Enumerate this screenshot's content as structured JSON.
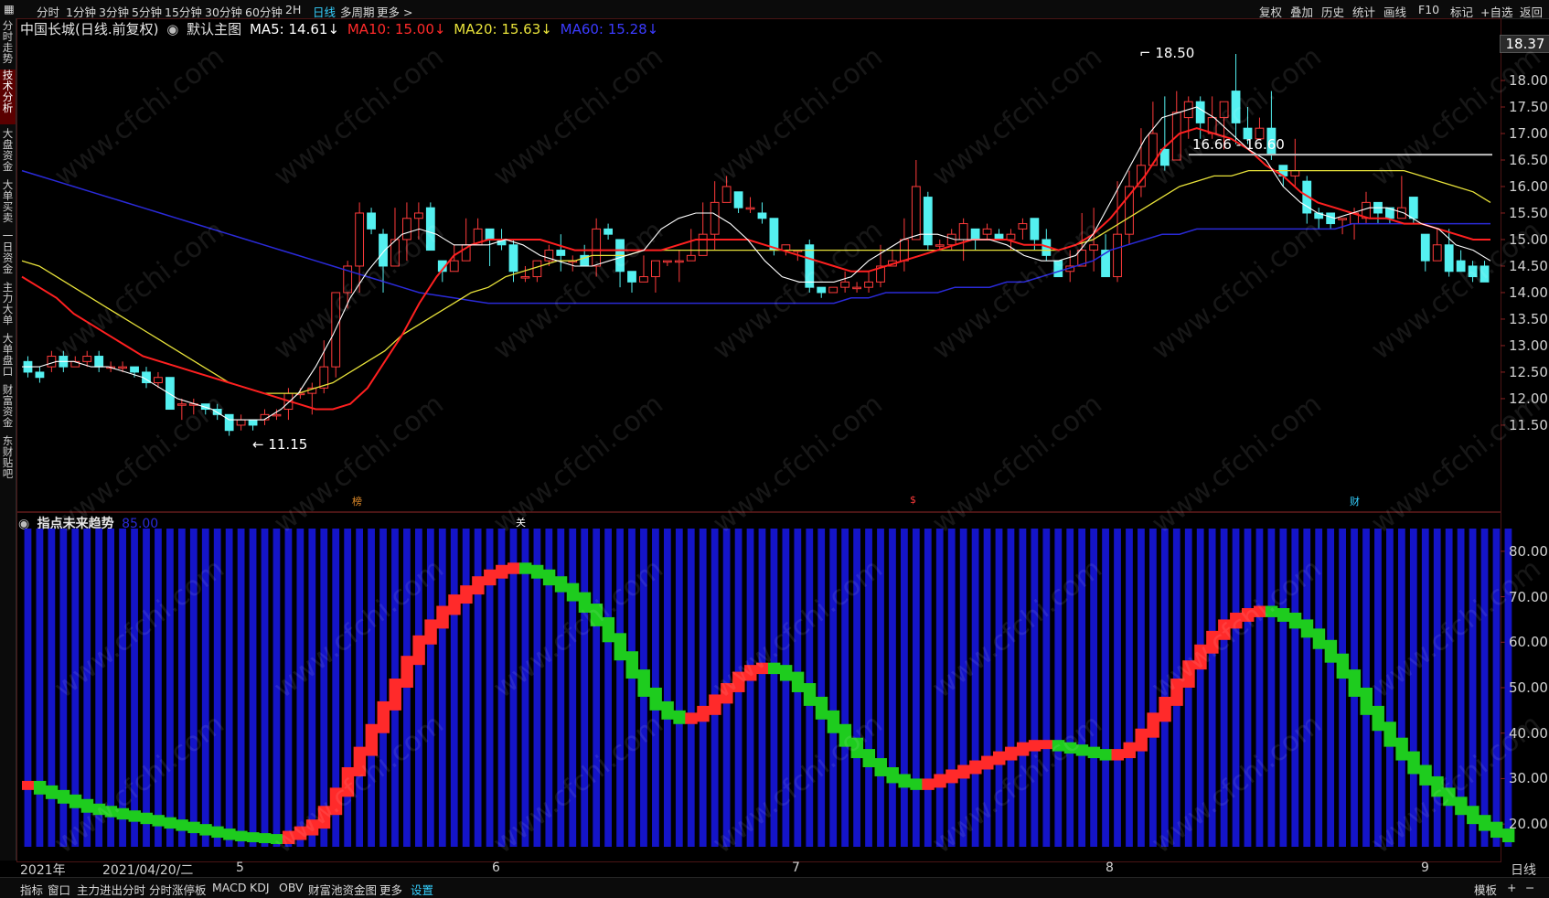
{
  "topbar": {
    "left_items": [
      "分时",
      "1分钟",
      "3分钟",
      "5分钟",
      "15分钟",
      "30分钟",
      "60分钟",
      "2H",
      "日线",
      "多周期",
      "更多 >"
    ],
    "active_item": "日线",
    "right_items": [
      "复权",
      "叠加",
      "历史",
      "统计",
      "画线",
      "F10",
      "标记",
      "+自选",
      "返回"
    ]
  },
  "sidebar": {
    "items": [
      "分时走势",
      "技术分析",
      "大盘资金",
      "大单买卖",
      "一日资金",
      "主力大单",
      "大单盘口",
      "财富资金",
      "东财贴吧"
    ],
    "active": "技术分析"
  },
  "legend": {
    "stock": "中国长城(日线.前复权)",
    "template": "默认主图",
    "ma5": "MA5: 14.61↓",
    "ma10": "MA10: 15.00↓",
    "ma20": "MA20: 15.63↓",
    "ma60": "MA60: 15.28↓"
  },
  "colors": {
    "up": "#ff3b3b",
    "down": "#54f0f0",
    "ma5": "#ffffff",
    "ma10": "#ff2020",
    "ma20": "#e8e23a",
    "ma60": "#2a2ad8",
    "osc_blue": "#1414c8",
    "osc_red": "#ff2a2a",
    "osc_green": "#1ecc1e"
  },
  "price_box": "18.37",
  "annotations": {
    "high": "18.50",
    "low": "11.15",
    "hline_label": "16.66 - 16.60",
    "markers": [
      "榜",
      "$",
      "财"
    ]
  },
  "sub_legend": {
    "title": "指点未来趋势",
    "value": "85.00"
  },
  "sub_marker": "关",
  "bottombar": {
    "items": [
      "指标",
      "窗口",
      "主力进出分时",
      "分时涨停板",
      "MACD",
      "KDJ",
      "OBV",
      "财富池资金图",
      "更多",
      "设置"
    ],
    "active": "设置",
    "right_items": [
      "模板",
      "+",
      "−"
    ]
  },
  "watermark": "www.cfchi.com",
  "chart_data": [
    {
      "type": "candlestick",
      "title": "中国长城(日线.前复权)",
      "period_label": "日线",
      "x_labels": [
        "2021年",
        "2021/04/20/二",
        "5",
        "6",
        "7",
        "8",
        "9"
      ],
      "ylim": [
        11.15,
        18.5
      ],
      "yticks": [
        11.5,
        12.0,
        12.5,
        13.0,
        13.5,
        14.0,
        14.5,
        15.0,
        15.5,
        16.0,
        16.5,
        17.0,
        17.5,
        18.0
      ],
      "candles": [
        [
          12.7,
          12.5,
          12.8,
          12.4
        ],
        [
          12.5,
          12.4,
          12.6,
          12.3
        ],
        [
          12.6,
          12.8,
          12.9,
          12.5
        ],
        [
          12.8,
          12.6,
          12.9,
          12.5
        ],
        [
          12.6,
          12.7,
          12.8,
          12.6
        ],
        [
          12.7,
          12.8,
          12.9,
          12.6
        ],
        [
          12.8,
          12.6,
          12.9,
          12.5
        ],
        [
          12.6,
          12.6,
          12.7,
          12.5
        ],
        [
          12.6,
          12.6,
          12.7,
          12.5
        ],
        [
          12.6,
          12.5,
          12.6,
          12.4
        ],
        [
          12.5,
          12.3,
          12.6,
          12.2
        ],
        [
          12.3,
          12.4,
          12.5,
          12.2
        ],
        [
          12.4,
          11.8,
          12.4,
          11.8
        ],
        [
          11.9,
          11.9,
          12.0,
          11.6
        ],
        [
          11.9,
          11.9,
          12.0,
          11.7
        ],
        [
          11.9,
          11.8,
          11.9,
          11.7
        ],
        [
          11.8,
          11.7,
          11.9,
          11.6
        ],
        [
          11.7,
          11.4,
          11.7,
          11.3
        ],
        [
          11.5,
          11.6,
          11.7,
          11.4
        ],
        [
          11.6,
          11.5,
          11.6,
          11.4
        ],
        [
          11.6,
          11.7,
          11.8,
          11.5
        ],
        [
          11.7,
          11.7,
          11.8,
          11.6
        ],
        [
          11.8,
          12.1,
          12.2,
          11.6
        ],
        [
          12.1,
          12.1,
          12.2,
          12.0
        ],
        [
          12.1,
          12.2,
          12.3,
          11.7
        ],
        [
          12.2,
          12.6,
          13.1,
          12.1
        ],
        [
          12.6,
          14.0,
          14.0,
          12.4
        ],
        [
          14.0,
          14.5,
          14.6,
          13.7
        ],
        [
          14.5,
          15.5,
          15.7,
          14.0
        ],
        [
          15.5,
          15.2,
          15.6,
          15.1
        ],
        [
          15.1,
          14.5,
          15.2,
          14.0
        ],
        [
          14.5,
          15.0,
          15.6,
          14.6
        ],
        [
          15.0,
          15.4,
          15.7,
          14.6
        ],
        [
          15.4,
          15.5,
          15.7,
          15.0
        ],
        [
          15.6,
          14.8,
          15.7,
          14.8
        ],
        [
          14.6,
          14.4,
          14.6,
          14.2
        ],
        [
          14.4,
          14.6,
          14.9,
          14.4
        ],
        [
          14.6,
          14.9,
          15.4,
          14.6
        ],
        [
          14.9,
          15.2,
          15.4,
          14.9
        ],
        [
          15.2,
          15.0,
          15.2,
          14.5
        ],
        [
          15.0,
          14.9,
          15.2,
          14.8
        ],
        [
          14.9,
          14.4,
          15.0,
          14.2
        ],
        [
          14.3,
          14.3,
          14.5,
          14.2
        ],
        [
          14.3,
          14.6,
          14.6,
          14.2
        ],
        [
          14.6,
          14.8,
          14.9,
          14.5
        ],
        [
          14.8,
          14.7,
          15.1,
          14.4
        ],
        [
          14.6,
          14.6,
          14.7,
          14.4
        ],
        [
          14.7,
          14.5,
          14.9,
          14.5
        ],
        [
          14.5,
          15.2,
          15.4,
          14.3
        ],
        [
          15.2,
          15.1,
          15.3,
          15.0
        ],
        [
          15.0,
          14.4,
          15.0,
          14.1
        ],
        [
          14.4,
          14.2,
          14.4,
          14.0
        ],
        [
          14.2,
          14.3,
          14.7,
          14.2
        ],
        [
          14.3,
          14.6,
          14.6,
          14.0
        ],
        [
          14.6,
          14.6,
          14.6,
          14.5
        ],
        [
          14.6,
          14.6,
          14.8,
          14.2
        ],
        [
          14.6,
          14.7,
          15.2,
          14.6
        ],
        [
          14.7,
          15.1,
          15.7,
          14.8
        ],
        [
          15.1,
          15.7,
          16.1,
          14.8
        ],
        [
          15.7,
          16.0,
          16.2,
          15.8
        ],
        [
          15.9,
          15.6,
          15.9,
          15.5
        ],
        [
          15.6,
          15.6,
          15.8,
          15.5
        ],
        [
          15.5,
          15.4,
          15.7,
          15.3
        ],
        [
          15.4,
          14.8,
          15.4,
          14.7
        ],
        [
          14.8,
          14.9,
          14.9,
          14.7
        ],
        [
          14.8,
          14.8,
          14.8,
          14.6
        ],
        [
          14.9,
          14.1,
          15.0,
          14.0
        ],
        [
          14.1,
          14.0,
          14.1,
          13.9
        ],
        [
          14.0,
          14.1,
          14.1,
          14.0
        ],
        [
          14.1,
          14.2,
          14.4,
          14.0
        ],
        [
          14.1,
          14.1,
          14.2,
          14.0
        ],
        [
          14.1,
          14.2,
          14.4,
          14.0
        ],
        [
          14.2,
          14.5,
          14.9,
          14.1
        ],
        [
          14.5,
          14.6,
          14.8,
          14.5
        ],
        [
          14.6,
          15.0,
          15.4,
          14.4
        ],
        [
          15.0,
          16.0,
          16.5,
          15.0
        ],
        [
          15.8,
          14.9,
          15.9,
          14.8
        ],
        [
          14.9,
          14.9,
          15.0,
          14.8
        ],
        [
          14.9,
          15.1,
          15.2,
          14.8
        ],
        [
          15.0,
          15.3,
          15.4,
          14.6
        ],
        [
          15.2,
          15.0,
          15.2,
          14.8
        ],
        [
          15.1,
          15.2,
          15.3,
          15.0
        ],
        [
          15.1,
          15.0,
          15.2,
          15.0
        ],
        [
          15.0,
          15.1,
          15.2,
          14.8
        ],
        [
          15.2,
          15.3,
          15.4,
          15.0
        ],
        [
          15.4,
          15.0,
          15.4,
          14.8
        ],
        [
          15.0,
          14.7,
          15.2,
          14.6
        ],
        [
          14.6,
          14.3,
          14.6,
          14.3
        ],
        [
          14.4,
          14.5,
          14.8,
          14.2
        ],
        [
          14.5,
          14.8,
          15.5,
          14.5
        ],
        [
          14.8,
          14.9,
          15.6,
          14.4
        ],
        [
          14.8,
          14.3,
          15.1,
          14.3
        ],
        [
          14.3,
          15.1,
          16.1,
          14.2
        ],
        [
          15.1,
          16.0,
          16.3,
          14.9
        ],
        [
          16.0,
          16.4,
          17.1,
          15.8
        ],
        [
          16.4,
          17.0,
          17.6,
          16.4
        ],
        [
          16.7,
          16.4,
          17.7,
          16.3
        ],
        [
          16.5,
          17.4,
          17.8,
          16.5
        ],
        [
          17.3,
          17.6,
          17.7,
          16.9
        ],
        [
          17.6,
          17.2,
          17.7,
          16.9
        ],
        [
          17.0,
          17.3,
          17.7,
          16.9
        ],
        [
          17.3,
          17.6,
          17.6,
          16.7
        ],
        [
          17.8,
          17.2,
          18.5,
          16.8
        ],
        [
          17.1,
          16.9,
          17.5,
          16.8
        ],
        [
          16.9,
          17.1,
          17.3,
          16.9
        ],
        [
          17.1,
          16.6,
          17.8,
          16.5
        ],
        [
          16.4,
          16.2,
          16.4,
          16.0
        ],
        [
          16.2,
          16.3,
          16.9,
          16.0
        ],
        [
          16.1,
          15.5,
          16.2,
          15.3
        ],
        [
          15.5,
          15.4,
          15.6,
          15.2
        ],
        [
          15.5,
          15.3,
          15.4,
          15.2
        ],
        [
          15.4,
          15.4,
          15.3,
          15.1
        ],
        [
          15.3,
          15.5,
          15.6,
          15.0
        ],
        [
          15.4,
          15.7,
          15.9,
          15.3
        ],
        [
          15.7,
          15.5,
          15.7,
          15.3
        ],
        [
          15.6,
          15.4,
          15.6,
          15.3
        ],
        [
          15.4,
          15.6,
          16.2,
          15.4
        ],
        [
          15.8,
          15.4,
          15.8,
          15.3
        ],
        [
          15.1,
          14.6,
          15.1,
          14.4
        ],
        [
          14.6,
          14.9,
          15.2,
          14.6
        ],
        [
          14.9,
          14.4,
          15.2,
          14.3
        ],
        [
          14.6,
          14.4,
          14.8,
          14.4
        ],
        [
          14.5,
          14.3,
          14.6,
          14.2
        ],
        [
          14.5,
          14.2,
          14.6,
          14.2
        ]
      ],
      "ma5": [
        12.6,
        12.6,
        12.7,
        12.7,
        12.6,
        12.6,
        12.5,
        12.4,
        12.2,
        12.0,
        11.9,
        11.8,
        11.6,
        11.6,
        11.6,
        11.8,
        12.1,
        12.6,
        13.2,
        13.9,
        14.4,
        14.8,
        15.1,
        15.2,
        15.1,
        14.9,
        14.9,
        14.9,
        15.0,
        14.9,
        14.7,
        14.6,
        14.5,
        14.5,
        14.6,
        14.7,
        14.8,
        15.2,
        15.4,
        15.5,
        15.5,
        15.3,
        15.0,
        14.6,
        14.3,
        14.2,
        14.2,
        14.2,
        14.3,
        14.6,
        14.8,
        15.0,
        15.1,
        15.1,
        15.0,
        15.0,
        15.0,
        14.9,
        14.7,
        14.6,
        14.6,
        14.7,
        15.1,
        15.7,
        16.3,
        16.9,
        17.3,
        17.4,
        17.5,
        17.3,
        17.0,
        16.7,
        16.5,
        16.0,
        15.7,
        15.5,
        15.4,
        15.5,
        15.6,
        15.6,
        15.5,
        15.3,
        15.2,
        14.9,
        14.8,
        14.6
      ],
      "ma10": [
        14.3,
        14.1,
        13.9,
        13.6,
        13.4,
        13.2,
        13.0,
        12.8,
        12.7,
        12.6,
        12.5,
        12.4,
        12.3,
        12.2,
        12.1,
        12.0,
        11.9,
        11.8,
        11.8,
        11.9,
        12.2,
        12.7,
        13.2,
        13.8,
        14.3,
        14.7,
        14.9,
        15.0,
        15.0,
        15.0,
        15.0,
        14.9,
        14.8,
        14.8,
        14.8,
        14.8,
        14.8,
        14.8,
        14.9,
        15.0,
        15.0,
        15.0,
        15.0,
        14.9,
        14.8,
        14.7,
        14.6,
        14.5,
        14.4,
        14.4,
        14.5,
        14.6,
        14.7,
        14.8,
        14.9,
        15.0,
        15.0,
        15.0,
        14.9,
        14.9,
        14.8,
        14.9,
        15.1,
        15.4,
        15.8,
        16.2,
        16.7,
        17.0,
        17.1,
        17.0,
        16.9,
        16.7,
        16.4,
        16.2,
        15.9,
        15.7,
        15.6,
        15.5,
        15.4,
        15.4,
        15.3,
        15.3,
        15.2,
        15.1,
        15.0,
        15.0
      ],
      "ma20": [
        14.6,
        14.5,
        14.3,
        14.1,
        13.9,
        13.7,
        13.5,
        13.3,
        13.1,
        12.9,
        12.7,
        12.5,
        12.3,
        12.2,
        12.1,
        12.1,
        12.1,
        12.2,
        12.3,
        12.5,
        12.7,
        12.9,
        13.2,
        13.4,
        13.6,
        13.8,
        14.0,
        14.1,
        14.3,
        14.4,
        14.5,
        14.6,
        14.6,
        14.7,
        14.7,
        14.7,
        14.8,
        14.8,
        14.8,
        14.8,
        14.8,
        14.8,
        14.8,
        14.8,
        14.8,
        14.8,
        14.8,
        14.8,
        14.8,
        14.8,
        14.8,
        14.8,
        14.8,
        14.8,
        14.8,
        14.8,
        14.8,
        14.8,
        14.8,
        14.8,
        14.8,
        14.9,
        15.0,
        15.2,
        15.4,
        15.6,
        15.8,
        16.0,
        16.1,
        16.2,
        16.2,
        16.3,
        16.3,
        16.3,
        16.3,
        16.3,
        16.3,
        16.3,
        16.3,
        16.3,
        16.3,
        16.2,
        16.1,
        16.0,
        15.9,
        15.7
      ],
      "ma60": [
        16.3,
        16.2,
        16.1,
        16.0,
        15.9,
        15.8,
        15.7,
        15.6,
        15.5,
        15.4,
        15.3,
        15.2,
        15.1,
        15.0,
        14.9,
        14.8,
        14.7,
        14.6,
        14.5,
        14.4,
        14.3,
        14.2,
        14.1,
        14.0,
        13.95,
        13.9,
        13.85,
        13.8,
        13.8,
        13.8,
        13.8,
        13.8,
        13.8,
        13.8,
        13.8,
        13.8,
        13.8,
        13.8,
        13.8,
        13.8,
        13.8,
        13.8,
        13.8,
        13.8,
        13.8,
        13.8,
        13.8,
        13.8,
        13.9,
        13.9,
        14.0,
        14.0,
        14.0,
        14.0,
        14.1,
        14.1,
        14.1,
        14.2,
        14.2,
        14.3,
        14.4,
        14.5,
        14.6,
        14.8,
        14.9,
        15.0,
        15.1,
        15.1,
        15.2,
        15.2,
        15.2,
        15.2,
        15.2,
        15.2,
        15.2,
        15.2,
        15.2,
        15.3,
        15.3,
        15.3,
        15.3,
        15.3,
        15.3,
        15.3,
        15.3,
        15.3
      ]
    },
    {
      "type": "bar",
      "title": "指点未来趋势",
      "ylim": [
        15,
        85
      ],
      "yticks": [
        20,
        30,
        40,
        50,
        60,
        70,
        80
      ],
      "bar_top": 85,
      "values": [
        28.5,
        27.5,
        26.5,
        25.5,
        24.5,
        23.5,
        23.0,
        22.5,
        22.0,
        21.5,
        21.0,
        20.5,
        20.0,
        19.5,
        19.0,
        18.5,
        18.0,
        17.5,
        17.2,
        17.0,
        16.8,
        16.6,
        17.5,
        18.5,
        20.0,
        23.0,
        27.0,
        31.5,
        36.0,
        41.0,
        46.0,
        51.0,
        56.0,
        60.5,
        64.0,
        67.0,
        69.5,
        71.5,
        73.5,
        75.0,
        76.0,
        76.5,
        76.0,
        75.0,
        73.5,
        72.0,
        70.0,
        67.5,
        64.5,
        61.0,
        57.0,
        53.0,
        49.0,
        46.0,
        44.0,
        43.0,
        43.5,
        45.0,
        47.5,
        50.0,
        52.5,
        54.0,
        54.5,
        54.0,
        52.5,
        50.0,
        47.0,
        44.0,
        41.0,
        38.0,
        35.5,
        33.5,
        31.5,
        30.0,
        29.0,
        28.5,
        29.0,
        30.0,
        31.0,
        32.0,
        33.0,
        34.0,
        35.0,
        36.0,
        37.0,
        37.5,
        37.5,
        37.0,
        36.5,
        36.0,
        35.5,
        35.0,
        35.5,
        37.0,
        40.0,
        43.5,
        47.0,
        51.0,
        55.0,
        58.5,
        61.5,
        64.0,
        65.5,
        66.5,
        67.0,
        66.5,
        65.5,
        64.0,
        62.0,
        59.5,
        56.5,
        53.0,
        49.0,
        45.0,
        41.5,
        38.0,
        35.0,
        32.0,
        29.5,
        27.0,
        25.0,
        23.0,
        21.0,
        19.5,
        18.0,
        17.0
      ]
    }
  ]
}
